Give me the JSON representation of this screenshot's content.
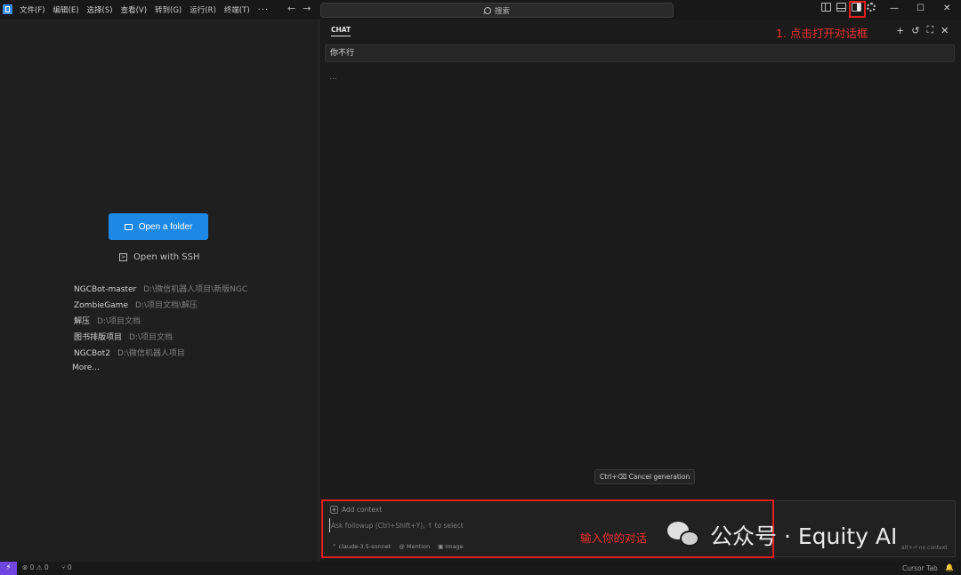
{
  "titlebar": {
    "menu": [
      "文件(F)",
      "编辑(E)",
      "选择(S)",
      "查看(V)",
      "转到(G)",
      "运行(R)",
      "终端(T)"
    ],
    "more": "···",
    "back": "←",
    "forward": "→",
    "search_label": "搜索",
    "window_minimize": "—",
    "window_maximize": "☐",
    "window_close": "✕"
  },
  "welcome": {
    "open_folder_label": "Open a folder",
    "open_ssh_label": "Open with SSH",
    "recent": [
      {
        "name": "NGCBot-master",
        "path": "D:\\微信机器人项目\\新版NGC"
      },
      {
        "name": "ZombieGame",
        "path": "D:\\项目文档\\解压"
      },
      {
        "name": "解压",
        "path": "D:\\项目文档"
      },
      {
        "name": "图书排版项目",
        "path": "D:\\项目文档"
      },
      {
        "name": "NGCBot2",
        "path": "D:\\微信机器人项目"
      }
    ],
    "more_label": "More..."
  },
  "chat": {
    "tab_label": "CHAT",
    "annotation_top": "1. 点击打开对话框",
    "user_message": "你不行",
    "loading": "...",
    "cancel_label": "Ctrl+⌫ Cancel generation",
    "add_context_label": "Add context",
    "input_placeholder": "Ask followup (Ctrl+Shift+Y), ↑ to select",
    "model_label": "claude-3.5-sonnet",
    "mention_label": "Mention",
    "image_label": "Image",
    "no_context_label": "alt+⏎ no context",
    "annotation_bottom": "输入你的对话"
  },
  "watermark": {
    "text": "公众号 · Equity AI"
  },
  "statusbar": {
    "problems": "⊗ 0 ⚠ 0",
    "ports": "⑂ 0",
    "cursor_tab": "Cursor Tab",
    "bell": "🔔"
  },
  "colors": {
    "accent_blue": "#1e88e5",
    "annotation_red": "#e21f1f",
    "remote_purple": "#6f46e0",
    "background": "#1f1f1f"
  }
}
